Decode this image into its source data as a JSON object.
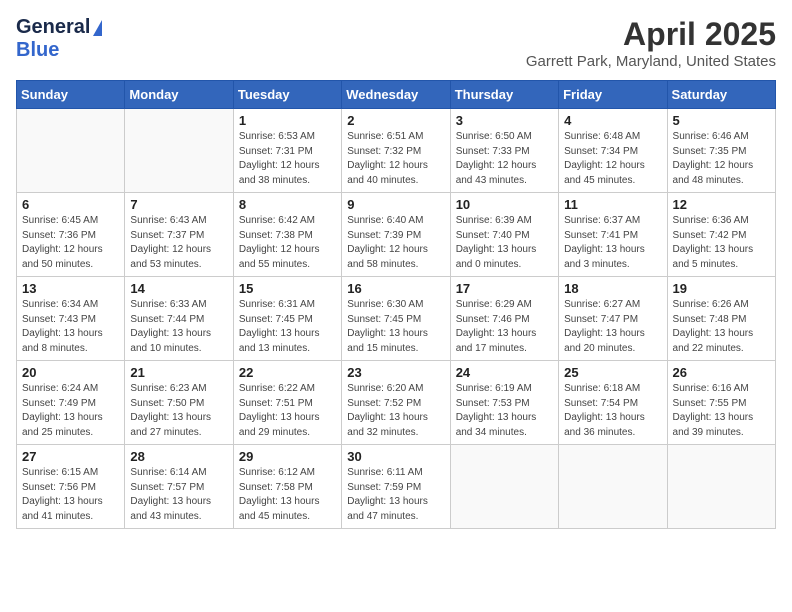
{
  "logo": {
    "line1": "General",
    "line2": "Blue"
  },
  "title": "April 2025",
  "subtitle": "Garrett Park, Maryland, United States",
  "days_of_week": [
    "Sunday",
    "Monday",
    "Tuesday",
    "Wednesday",
    "Thursday",
    "Friday",
    "Saturday"
  ],
  "weeks": [
    [
      {
        "day": "",
        "info": ""
      },
      {
        "day": "",
        "info": ""
      },
      {
        "day": "1",
        "info": "Sunrise: 6:53 AM\nSunset: 7:31 PM\nDaylight: 12 hours and 38 minutes."
      },
      {
        "day": "2",
        "info": "Sunrise: 6:51 AM\nSunset: 7:32 PM\nDaylight: 12 hours and 40 minutes."
      },
      {
        "day": "3",
        "info": "Sunrise: 6:50 AM\nSunset: 7:33 PM\nDaylight: 12 hours and 43 minutes."
      },
      {
        "day": "4",
        "info": "Sunrise: 6:48 AM\nSunset: 7:34 PM\nDaylight: 12 hours and 45 minutes."
      },
      {
        "day": "5",
        "info": "Sunrise: 6:46 AM\nSunset: 7:35 PM\nDaylight: 12 hours and 48 minutes."
      }
    ],
    [
      {
        "day": "6",
        "info": "Sunrise: 6:45 AM\nSunset: 7:36 PM\nDaylight: 12 hours and 50 minutes."
      },
      {
        "day": "7",
        "info": "Sunrise: 6:43 AM\nSunset: 7:37 PM\nDaylight: 12 hours and 53 minutes."
      },
      {
        "day": "8",
        "info": "Sunrise: 6:42 AM\nSunset: 7:38 PM\nDaylight: 12 hours and 55 minutes."
      },
      {
        "day": "9",
        "info": "Sunrise: 6:40 AM\nSunset: 7:39 PM\nDaylight: 12 hours and 58 minutes."
      },
      {
        "day": "10",
        "info": "Sunrise: 6:39 AM\nSunset: 7:40 PM\nDaylight: 13 hours and 0 minutes."
      },
      {
        "day": "11",
        "info": "Sunrise: 6:37 AM\nSunset: 7:41 PM\nDaylight: 13 hours and 3 minutes."
      },
      {
        "day": "12",
        "info": "Sunrise: 6:36 AM\nSunset: 7:42 PM\nDaylight: 13 hours and 5 minutes."
      }
    ],
    [
      {
        "day": "13",
        "info": "Sunrise: 6:34 AM\nSunset: 7:43 PM\nDaylight: 13 hours and 8 minutes."
      },
      {
        "day": "14",
        "info": "Sunrise: 6:33 AM\nSunset: 7:44 PM\nDaylight: 13 hours and 10 minutes."
      },
      {
        "day": "15",
        "info": "Sunrise: 6:31 AM\nSunset: 7:45 PM\nDaylight: 13 hours and 13 minutes."
      },
      {
        "day": "16",
        "info": "Sunrise: 6:30 AM\nSunset: 7:45 PM\nDaylight: 13 hours and 15 minutes."
      },
      {
        "day": "17",
        "info": "Sunrise: 6:29 AM\nSunset: 7:46 PM\nDaylight: 13 hours and 17 minutes."
      },
      {
        "day": "18",
        "info": "Sunrise: 6:27 AM\nSunset: 7:47 PM\nDaylight: 13 hours and 20 minutes."
      },
      {
        "day": "19",
        "info": "Sunrise: 6:26 AM\nSunset: 7:48 PM\nDaylight: 13 hours and 22 minutes."
      }
    ],
    [
      {
        "day": "20",
        "info": "Sunrise: 6:24 AM\nSunset: 7:49 PM\nDaylight: 13 hours and 25 minutes."
      },
      {
        "day": "21",
        "info": "Sunrise: 6:23 AM\nSunset: 7:50 PM\nDaylight: 13 hours and 27 minutes."
      },
      {
        "day": "22",
        "info": "Sunrise: 6:22 AM\nSunset: 7:51 PM\nDaylight: 13 hours and 29 minutes."
      },
      {
        "day": "23",
        "info": "Sunrise: 6:20 AM\nSunset: 7:52 PM\nDaylight: 13 hours and 32 minutes."
      },
      {
        "day": "24",
        "info": "Sunrise: 6:19 AM\nSunset: 7:53 PM\nDaylight: 13 hours and 34 minutes."
      },
      {
        "day": "25",
        "info": "Sunrise: 6:18 AM\nSunset: 7:54 PM\nDaylight: 13 hours and 36 minutes."
      },
      {
        "day": "26",
        "info": "Sunrise: 6:16 AM\nSunset: 7:55 PM\nDaylight: 13 hours and 39 minutes."
      }
    ],
    [
      {
        "day": "27",
        "info": "Sunrise: 6:15 AM\nSunset: 7:56 PM\nDaylight: 13 hours and 41 minutes."
      },
      {
        "day": "28",
        "info": "Sunrise: 6:14 AM\nSunset: 7:57 PM\nDaylight: 13 hours and 43 minutes."
      },
      {
        "day": "29",
        "info": "Sunrise: 6:12 AM\nSunset: 7:58 PM\nDaylight: 13 hours and 45 minutes."
      },
      {
        "day": "30",
        "info": "Sunrise: 6:11 AM\nSunset: 7:59 PM\nDaylight: 13 hours and 47 minutes."
      },
      {
        "day": "",
        "info": ""
      },
      {
        "day": "",
        "info": ""
      },
      {
        "day": "",
        "info": ""
      }
    ]
  ]
}
